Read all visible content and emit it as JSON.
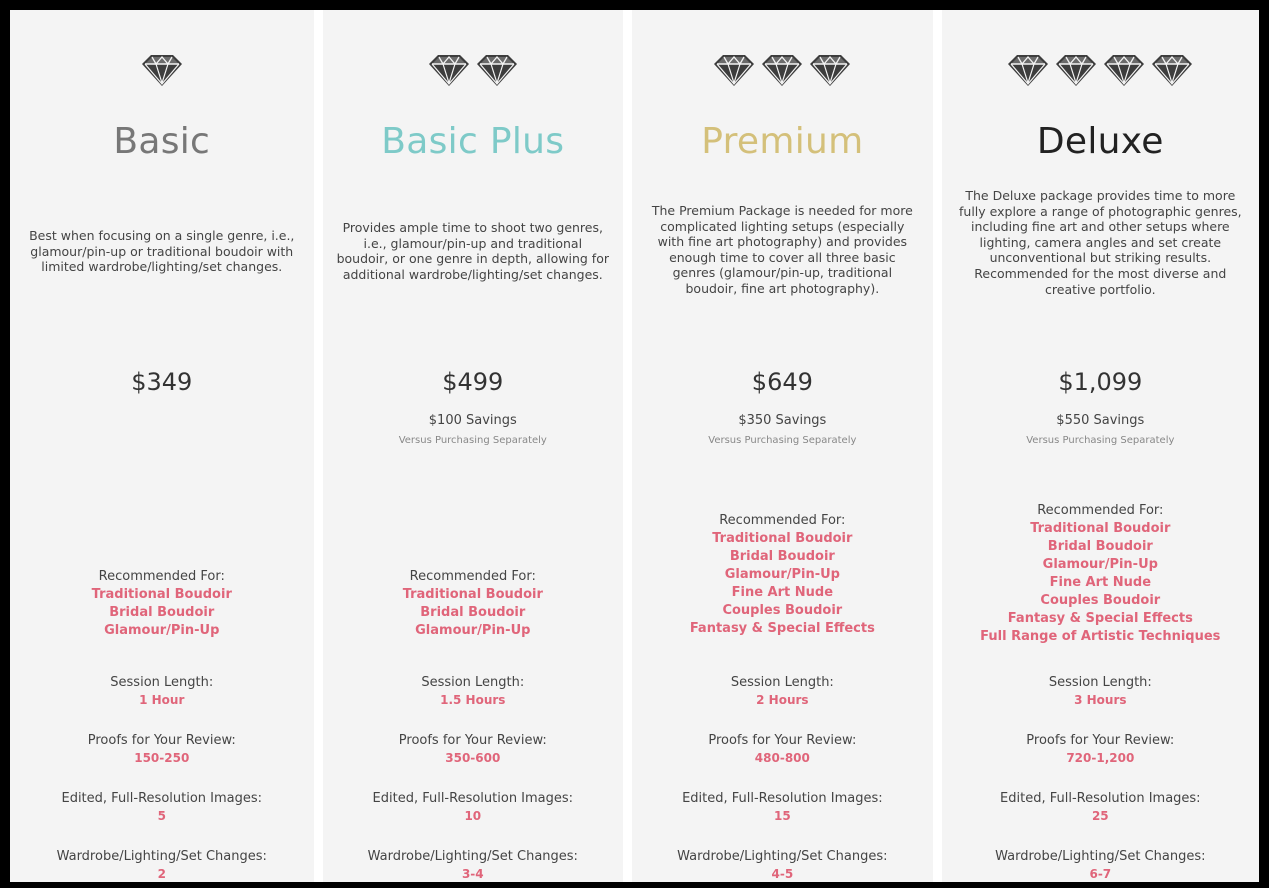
{
  "accent_color": "#e0657a",
  "diamond_icon": "diamond-icon",
  "labels": {
    "recommended_for": "Recommended For:",
    "session_length": "Session Length:",
    "proofs": "Proofs for Your Review:",
    "edited_images": "Edited, Full-Resolution Images:",
    "changes": "Wardrobe/Lighting/Set Changes:"
  },
  "packages": [
    {
      "name": "Basic",
      "title_color": "#777777",
      "diamond_count": 1,
      "description": "Best when focusing on a single genre, i.e., glamour/pin-up or traditional boudoir with limited wardrobe/lighting/set changes.",
      "price": "$349",
      "savings": "",
      "versus": "",
      "recommended": [
        "Traditional Boudoir",
        "Bridal Boudoir",
        "Glamour/Pin-Up"
      ],
      "session_length": "1 Hour",
      "proofs": "150-250",
      "edited_images": "5",
      "changes": "2"
    },
    {
      "name": "Basic Plus",
      "title_color": "#7ecac8",
      "diamond_count": 2,
      "description": "Provides ample time to shoot two genres, i.e., glamour/pin-up and traditional boudoir, or one genre in depth, allowing for additional wardrobe/lighting/set changes.",
      "price": "$499",
      "savings": "$100 Savings",
      "versus": "Versus Purchasing Separately",
      "recommended": [
        "Traditional Boudoir",
        "Bridal Boudoir",
        "Glamour/Pin-Up"
      ],
      "session_length": "1.5 Hours",
      "proofs": "350-600",
      "edited_images": "10",
      "changes": "3-4"
    },
    {
      "name": "Premium",
      "title_color": "#d4c07a",
      "diamond_count": 3,
      "description": "The Premium Package is needed for more complicated lighting setups (especially with fine art photography) and provides enough time to cover all three basic genres (glamour/pin-up, traditional boudoir, fine art photography).",
      "price": "$649",
      "savings": "$350 Savings",
      "versus": "Versus Purchasing Separately",
      "recommended": [
        "Traditional Boudoir",
        "Bridal Boudoir",
        "Glamour/Pin-Up",
        "Fine Art Nude",
        "Couples Boudoir",
        "Fantasy & Special Effects"
      ],
      "session_length": "2 Hours",
      "proofs": "480-800",
      "edited_images": "15",
      "changes": "4-5"
    },
    {
      "name": "Deluxe",
      "title_color": "#222222",
      "diamond_count": 4,
      "description": "The Deluxe package provides time to more fully explore a range of photographic genres, including fine art and other setups where lighting, camera angles and set create unconventional but striking results. Recommended for the most diverse and creative portfolio.",
      "price": "$1,099",
      "savings": "$550 Savings",
      "versus": "Versus Purchasing Separately",
      "recommended": [
        "Traditional Boudoir",
        "Bridal Boudoir",
        "Glamour/Pin-Up",
        "Fine Art Nude",
        "Couples Boudoir",
        "Fantasy & Special Effects",
        "Full Range of Artistic Techniques"
      ],
      "session_length": "3 Hours",
      "proofs": "720-1,200",
      "edited_images": "25",
      "changes": "6-7"
    }
  ]
}
